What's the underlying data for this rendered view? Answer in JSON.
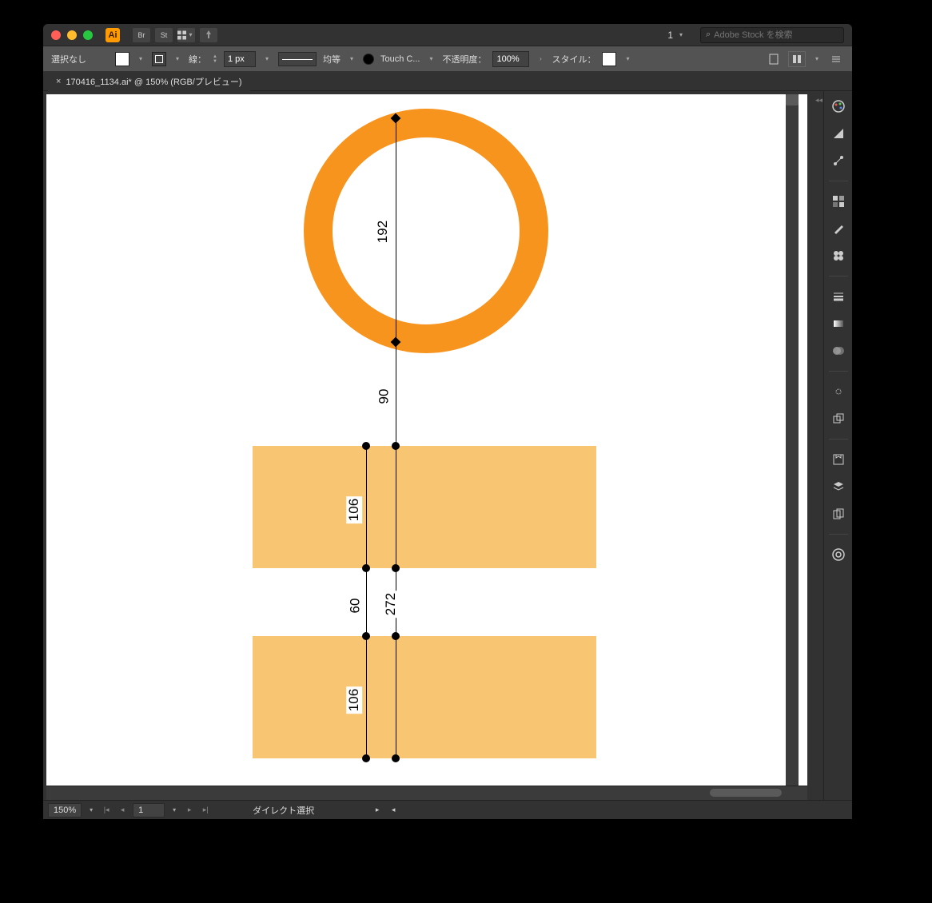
{
  "app": {
    "short": "Ai"
  },
  "titlebar": {
    "workspace": "1",
    "search_placeholder": "Adobe Stock を検索"
  },
  "controlbar": {
    "selection": "選択なし",
    "stroke_label": "線：",
    "stroke_width": "1 px",
    "stroke_profile": "均等",
    "brush_label": "Touch C...",
    "opacity_label": "不透明度：",
    "opacity_value": "100%",
    "style_label": "スタイル："
  },
  "doc": {
    "tab_title": "170416_1134.ai* @ 150% (RGB/プレビュー)"
  },
  "measurements": {
    "circle_inner": "192",
    "gap1": "90",
    "rect_h1": "106",
    "gap2": "60",
    "span": "272",
    "rect_h2": "106"
  },
  "statusbar": {
    "zoom": "150%",
    "page": "1",
    "tool": "ダイレクト選択"
  }
}
